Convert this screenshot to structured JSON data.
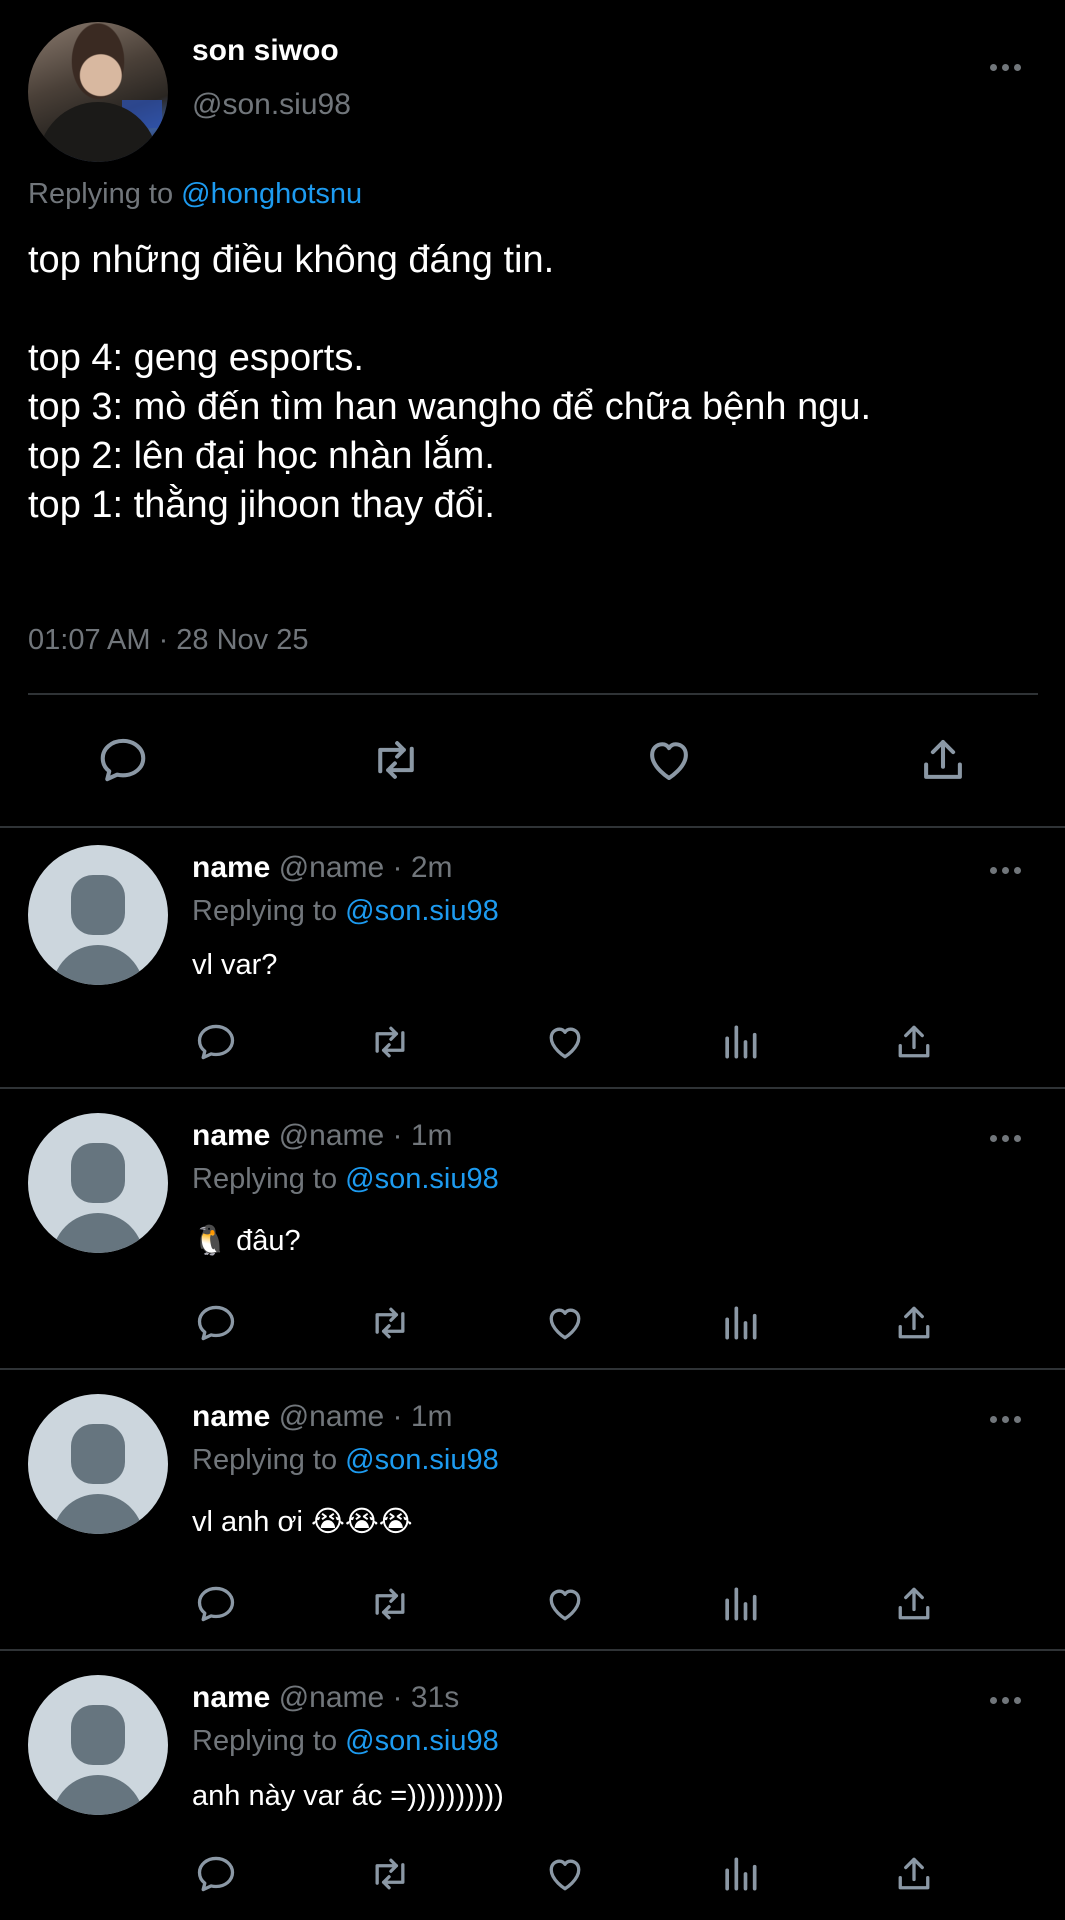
{
  "main_tweet": {
    "name": "son siwoo",
    "handle": "@son.siu98",
    "replying_prefix": "Replying to",
    "replying_handle": "@honghotsnu",
    "text": "top những điều không đáng tin.\n\ntop 4: geng esports.\ntop 3: mò đến tìm han wangho để chữa bệnh ngu.\ntop 2: lên đại học nhàn lắm.\ntop 1: thằng jihoon thay đổi.",
    "timestamp": "01:07 AM · 28 Nov 25",
    "actions": [
      "reply-icon",
      "retweet-icon",
      "like-icon",
      "share-icon"
    ]
  },
  "replies": [
    {
      "name": "name",
      "meta": "@name · 2m",
      "replying_prefix": "Replying to",
      "replying_handle": "@son.siu98",
      "text": "vl var?"
    },
    {
      "name": "name",
      "meta": "@name · 1m",
      "replying_prefix": "Replying to",
      "replying_handle": "@son.siu98",
      "emoji": "🐧",
      "text": "đâu?"
    },
    {
      "name": "name",
      "meta": "@name · 1m",
      "replying_prefix": "Replying to",
      "replying_handle": "@son.siu98",
      "text": "vl anh ơi",
      "emoji": "😭😭😭"
    },
    {
      "name": "name",
      "meta": "@name · 31s",
      "replying_prefix": "Replying to",
      "replying_handle": "@son.siu98",
      "text": "anh này var ác =))))))))))"
    }
  ],
  "reply_actions": [
    "reply-icon",
    "retweet-icon",
    "like-icon",
    "views-icon",
    "share-icon"
  ],
  "colors": {
    "background": "#000000",
    "text": "#ffffff",
    "secondary": "#71767b",
    "link": "#1d9bf0",
    "divider": "#2f3336",
    "default_avatar_bg": "#ccd6dd",
    "default_avatar_fg": "#66757f"
  }
}
